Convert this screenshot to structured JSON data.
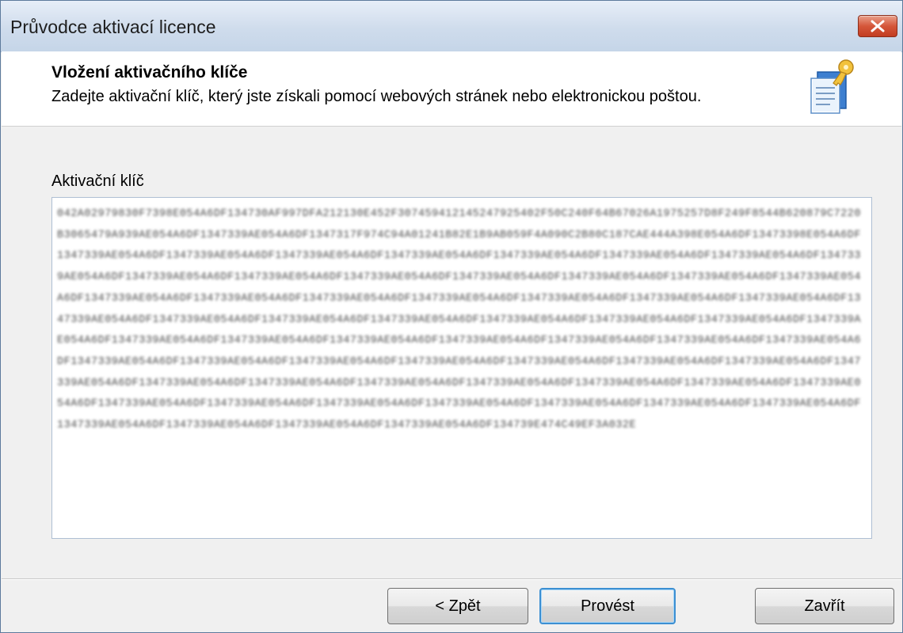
{
  "window": {
    "title": "Průvodce aktivací licence"
  },
  "header": {
    "title": "Vložení aktivačního klíče",
    "subtitle": "Zadejte aktivační klíč, který jste získali pomocí webových stránek nebo elektronickou poštou.",
    "icon": "license-key-document-icon"
  },
  "form": {
    "label": "Aktivační klíč",
    "key_value": "042A02979830F7398E054A6DF134730AF997DFA212130E452F307459412145247925402F50C240F64B67026A1975257D8F249F8544B620879C7220B3065479A939AE054A6DF1347339AE054A6DF1347317F974C94A01241B82E1B9AB059F4A090C2B80C187CAE444A398E054A6DF13473398E054A6DF1347339AE054A6DF1347339AE054A6DF1347339AE054A6DF1347339AE054A6DF1347339AE054A6DF1347339AE054A6DF1347339AE054A6DF1347339AE054A6DF1347339AE054A6DF1347339AE054A6DF1347339AE054A6DF1347339AE054A6DF1347339AE054A6DF1347339AE054A6DF1347339AE054A6DF1347339AE054A6DF1347339AE054A6DF1347339AE054A6DF1347339AE054A6DF1347339AE054A6DF1347339AE054A6DF1347339AE054A6DF1347339AE054A6DF1347339AE054A6DF1347339AE054A6DF1347339AE054A6DF1347339AE054A6DF1347339AE054A6DF1347339AE054A6DF1347339AE054A6DF1347339AE054A6DF1347339AE054A6DF1347339AE054A6DF1347339AE054A6DF1347339AE054A6DF1347339AE054A6DF1347339AE054A6DF1347339AE054A6DF1347339AE054A6DF1347339AE054A6DF1347339AE054A6DF1347339AE054A6DF1347339AE054A6DF1347339AE054A6DF1347339AE054A6DF1347339AE054A6DF1347339AE054A6DF1347339AE054A6DF1347339AE054A6DF1347339AE054A6DF1347339AE054A6DF1347339AE054A6DF1347339AE054A6DF1347339AE054A6DF1347339AE054A6DF1347339AE054A6DF1347339AE054A6DF1347339AE054A6DF1347339AE054A6DF1347339AE054A6DF1347339AE054A6DF1347339AE054A6DF1347339AE054A6DF134739E474C49EF3A032E"
  },
  "buttons": {
    "back": "< Zpět",
    "run": "Provést",
    "close": "Zavřít"
  },
  "colors": {
    "title_bar": "#cfdcec",
    "close_button": "#d5573a",
    "default_button_border": "#3c8fd2"
  }
}
